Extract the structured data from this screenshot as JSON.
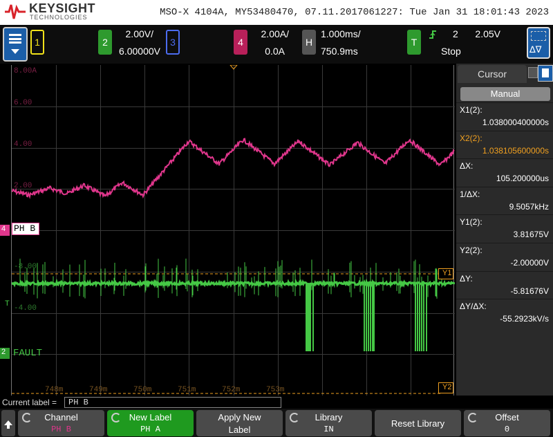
{
  "brand": {
    "name": "KEYSIGHT",
    "sub": "TECHNOLOGIES"
  },
  "instrument_info": "MSO-X 4104A, MY53480470, 07.11.2017061227: Tue Jan 31 18:01:43 2023",
  "header": {
    "ch1": {
      "number": "1"
    },
    "ch2": {
      "number": "2",
      "scale": "2.00V/",
      "offset": "6.00000V"
    },
    "ch3": {
      "number": "3"
    },
    "ch4": {
      "number": "4",
      "scale": "2.00A/",
      "offset": "0.0A"
    },
    "horizontal": {
      "key": "H",
      "timebase": "1.000ms/",
      "delay": "750.9ms"
    },
    "trigger": {
      "key": "T",
      "source": "2",
      "level": "2.05V",
      "state": "Stop"
    }
  },
  "screen": {
    "ch4_ylabels": [
      "8.00A",
      "6.00",
      "4.00",
      "2.00"
    ],
    "ch2_ylabels": [
      "-8.00",
      "-4.00"
    ],
    "xlabels": [
      "748m",
      "749m",
      "750m",
      "751m",
      "752m",
      "753m"
    ],
    "ch4_label": "PH B",
    "ch4_marker": "4",
    "ch2_label": "FAULT",
    "ch2_marker": "2",
    "trig_marker": "T",
    "cursor_y1": "Y1",
    "cursor_y2": "Y2"
  },
  "cursor_panel": {
    "tab": "Cursor",
    "mode": "Manual",
    "rows": [
      {
        "label": "X1(2):",
        "value": "1.038000400000s",
        "color": "#ffffff"
      },
      {
        "label": "X2(2):",
        "value": "1.038105600000s",
        "color": "#f0a020"
      },
      {
        "label": "ΔX:",
        "value": "105.200000us",
        "color": "#ffffff"
      },
      {
        "label": "1/ΔX:",
        "value": "9.5057kHz",
        "color": "#ffffff"
      },
      {
        "label": "Y1(2):",
        "value": "3.81675V",
        "color": "#ffffff"
      },
      {
        "label": "Y2(2):",
        "value": "-2.00000V",
        "color": "#ffffff"
      },
      {
        "label": "ΔY:",
        "value": "-5.81676V",
        "color": "#ffffff"
      },
      {
        "label": "ΔY/ΔX:",
        "value": "-55.2923kV/s",
        "color": "#ffffff"
      }
    ]
  },
  "current_label": {
    "caption": "Current label =",
    "value": "PH B"
  },
  "softkeys": [
    {
      "title": "Channel",
      "value": "PH B"
    },
    {
      "title": "New Label",
      "value": "PH A"
    },
    {
      "title": "Apply New",
      "value": "Label"
    },
    {
      "title": "Library",
      "value": "IN"
    },
    {
      "title": "Reset Library",
      "value": ""
    },
    {
      "title": "Offset",
      "value": "0"
    }
  ],
  "colors": {
    "ch1": "#f2e21a",
    "ch2": "#45c845",
    "ch3": "#4c6cf0",
    "ch4": "#e0368c",
    "cursor": "#f0a020"
  }
}
